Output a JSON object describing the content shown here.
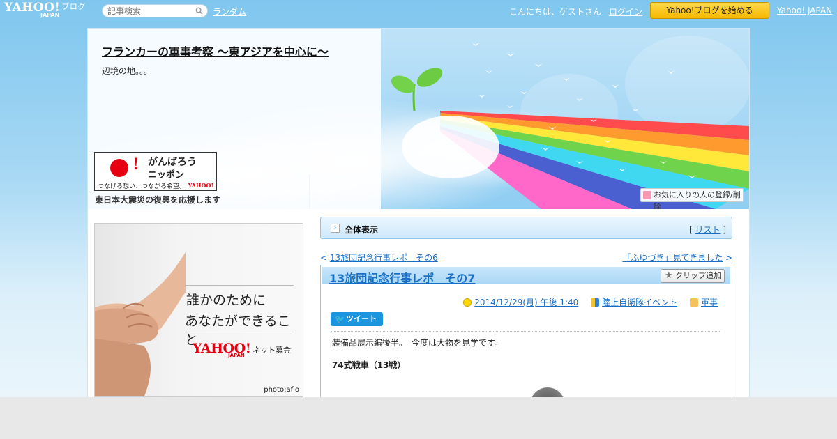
{
  "topbar": {
    "logo_main": "YAHOO!",
    "logo_suffix": "ブログ",
    "logo_sub": "JAPAN",
    "search_placeholder": "記事検索",
    "random_link": "ランダム",
    "greeting": "こんにちは、ゲストさん",
    "login_link": "ログイン",
    "start_button": "Yahoo!ブログを始める",
    "yahoo_japan_link": "Yahoo! JAPAN"
  },
  "header": {
    "blog_title": "フランカーの軍事考察 ～東アジアを中心に～",
    "blog_subtitle": "辺境の地。。。",
    "favorite_button": "お気に入りの人の登録/削除"
  },
  "sidebar": {
    "ganbaro": {
      "line1": "がんばろう",
      "line2": "ニッポン",
      "tagline": "つなげる想い、つながる希望。",
      "brand": "YAHOO!",
      "caption": "東日本大震災の復興を応援します"
    },
    "ad": {
      "line1": "誰かのために",
      "line2": "あなたができること",
      "brand": "YAHOO!",
      "brand_sub": "JAPAN",
      "service": "ネット募金",
      "credit": "photo:aflo"
    }
  },
  "main": {
    "allview_label": "全体表示",
    "list_link": "リスト",
    "prev_link": "13旅団記念行事レポ　その6",
    "next_link": "「ふゆづき」見てきました",
    "article": {
      "title": "13旅団記念行事レポ　その7",
      "clip_button": "クリップ追加",
      "date": "2014/12/29(月) 午後 1:40",
      "category1": "陸上自衛隊イベント",
      "category2": "軍事",
      "tweet_button": "ツイート",
      "body_text": "装備品展示編後半。　今度は大物を見学です。",
      "subheading": "74式戦車（13戦）"
    }
  },
  "colors": {
    "accent_blue": "#1a6fc2",
    "start_button_yellow": "#ffd84a",
    "yahoo_red": "#e60012"
  }
}
